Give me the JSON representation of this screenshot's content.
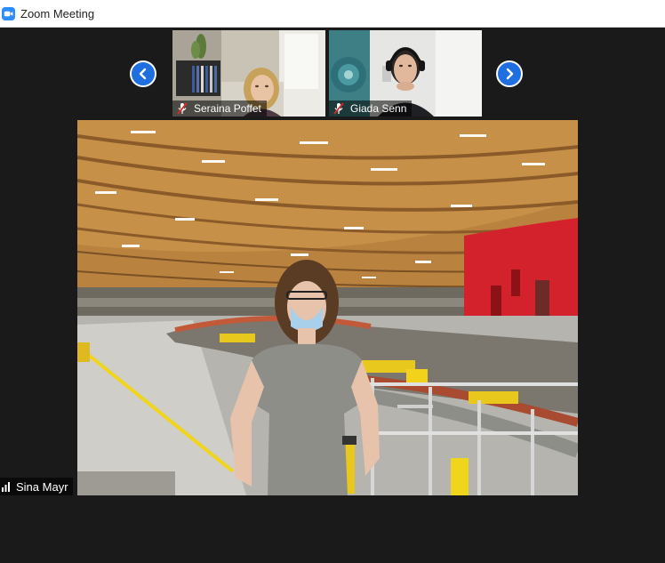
{
  "window": {
    "title": "Zoom Meeting",
    "icon": "zoom-camera-icon",
    "accent_color": "#2d8cff"
  },
  "gallery": {
    "prev_icon": "chevron-left-icon",
    "next_icon": "chevron-right-icon",
    "arrow_color": "#1f6fe0",
    "participants": [
      {
        "name": "Seraina Poffet",
        "muted": true,
        "status_icon": "microphone-muted-icon"
      },
      {
        "name": "Giada Senn",
        "muted": true,
        "status_icon": "microphone-muted-icon"
      }
    ]
  },
  "active_speaker": {
    "name": "Sina Mayr",
    "status_icon": "signal-bars-icon"
  }
}
